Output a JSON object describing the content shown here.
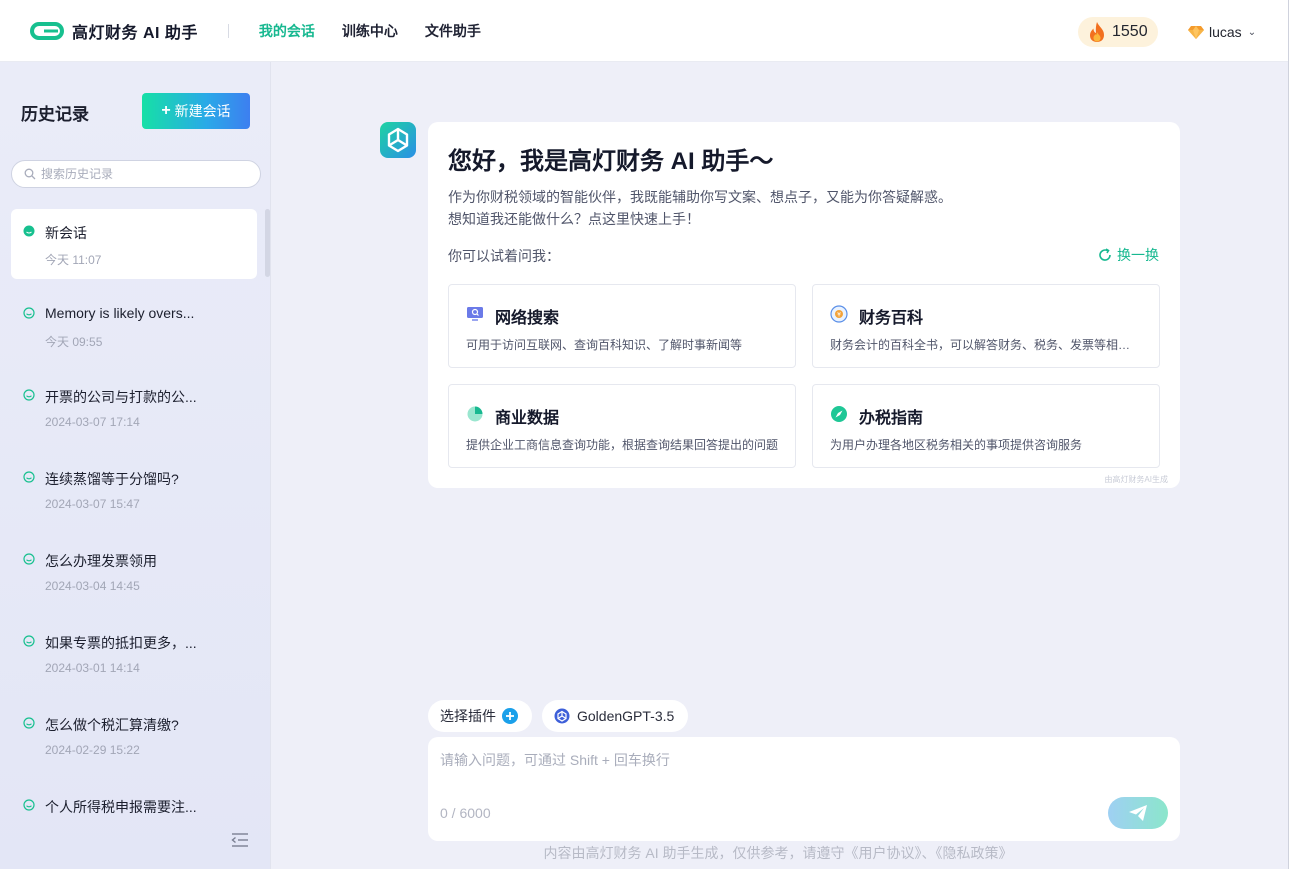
{
  "header": {
    "brand_name": "高灯财务 AI 助手",
    "nav": [
      {
        "label": "我的会话",
        "active": true
      },
      {
        "label": "训练中心",
        "active": false
      },
      {
        "label": "文件助手",
        "active": false
      }
    ],
    "points": "1550",
    "user_name": "lucas",
    "accent_color": "#17b890"
  },
  "sidebar": {
    "title": "历史记录",
    "new_button": "新建会话",
    "search_placeholder": "搜索历史记录",
    "items": [
      {
        "title": "新会话",
        "time": "今天 11:07",
        "active": true
      },
      {
        "title": "Memory is likely overs...",
        "time": "今天 09:55",
        "active": false
      },
      {
        "title": "开票的公司与打款的公...",
        "time": "2024-03-07 17:14",
        "active": false
      },
      {
        "title": "连续蒸馏等于分馏吗?",
        "time": "2024-03-07 15:47",
        "active": false
      },
      {
        "title": "怎么办理发票领用",
        "time": "2024-03-04 14:45",
        "active": false
      },
      {
        "title": "如果专票的抵扣更多，...",
        "time": "2024-03-01 14:14",
        "active": false
      },
      {
        "title": "怎么做个税汇算清缴?",
        "time": "2024-02-29 15:22",
        "active": false
      },
      {
        "title": "个人所得税申报需要注...",
        "time": "",
        "active": false
      }
    ]
  },
  "welcome": {
    "title": "您好，我是高灯财务 AI 助手～",
    "desc_line1": "作为你财税领域的智能伙伴，我既能辅助你写文案、想点子，又能为你答疑解惑。",
    "desc_line2": "想知道我还能做什么？点这里快速上手！",
    "try_label": "你可以试着问我：",
    "refresh_label": "换一换",
    "footnote": "由高灯财务AI生成",
    "cards": [
      {
        "title": "网络搜索",
        "desc": "可用于访问互联网、查询百科知识、了解时事新闻等",
        "icon": "monitor-search-icon"
      },
      {
        "title": "财务百科",
        "desc": "财务会计的百科全书，可以解答财务、税务、发票等相关问题",
        "icon": "finance-encyclopedia-icon"
      },
      {
        "title": "商业数据",
        "desc": "提供企业工商信息查询功能，根据查询结果回答提出的问题",
        "icon": "pie-chart-icon"
      },
      {
        "title": "办税指南",
        "desc": "为用户办理各地区税务相关的事项提供咨询服务",
        "icon": "compass-icon"
      }
    ]
  },
  "composer": {
    "plugin_label": "选择插件",
    "model_label": "GoldenGPT-3.5",
    "placeholder": "请输入问题，可通过 Shift + 回车换行",
    "counter": "0 / 6000",
    "disclaimer": "内容由高灯财务 AI 助手生成，仅供参考，请遵守《用户协议》、《隐私政策》"
  }
}
